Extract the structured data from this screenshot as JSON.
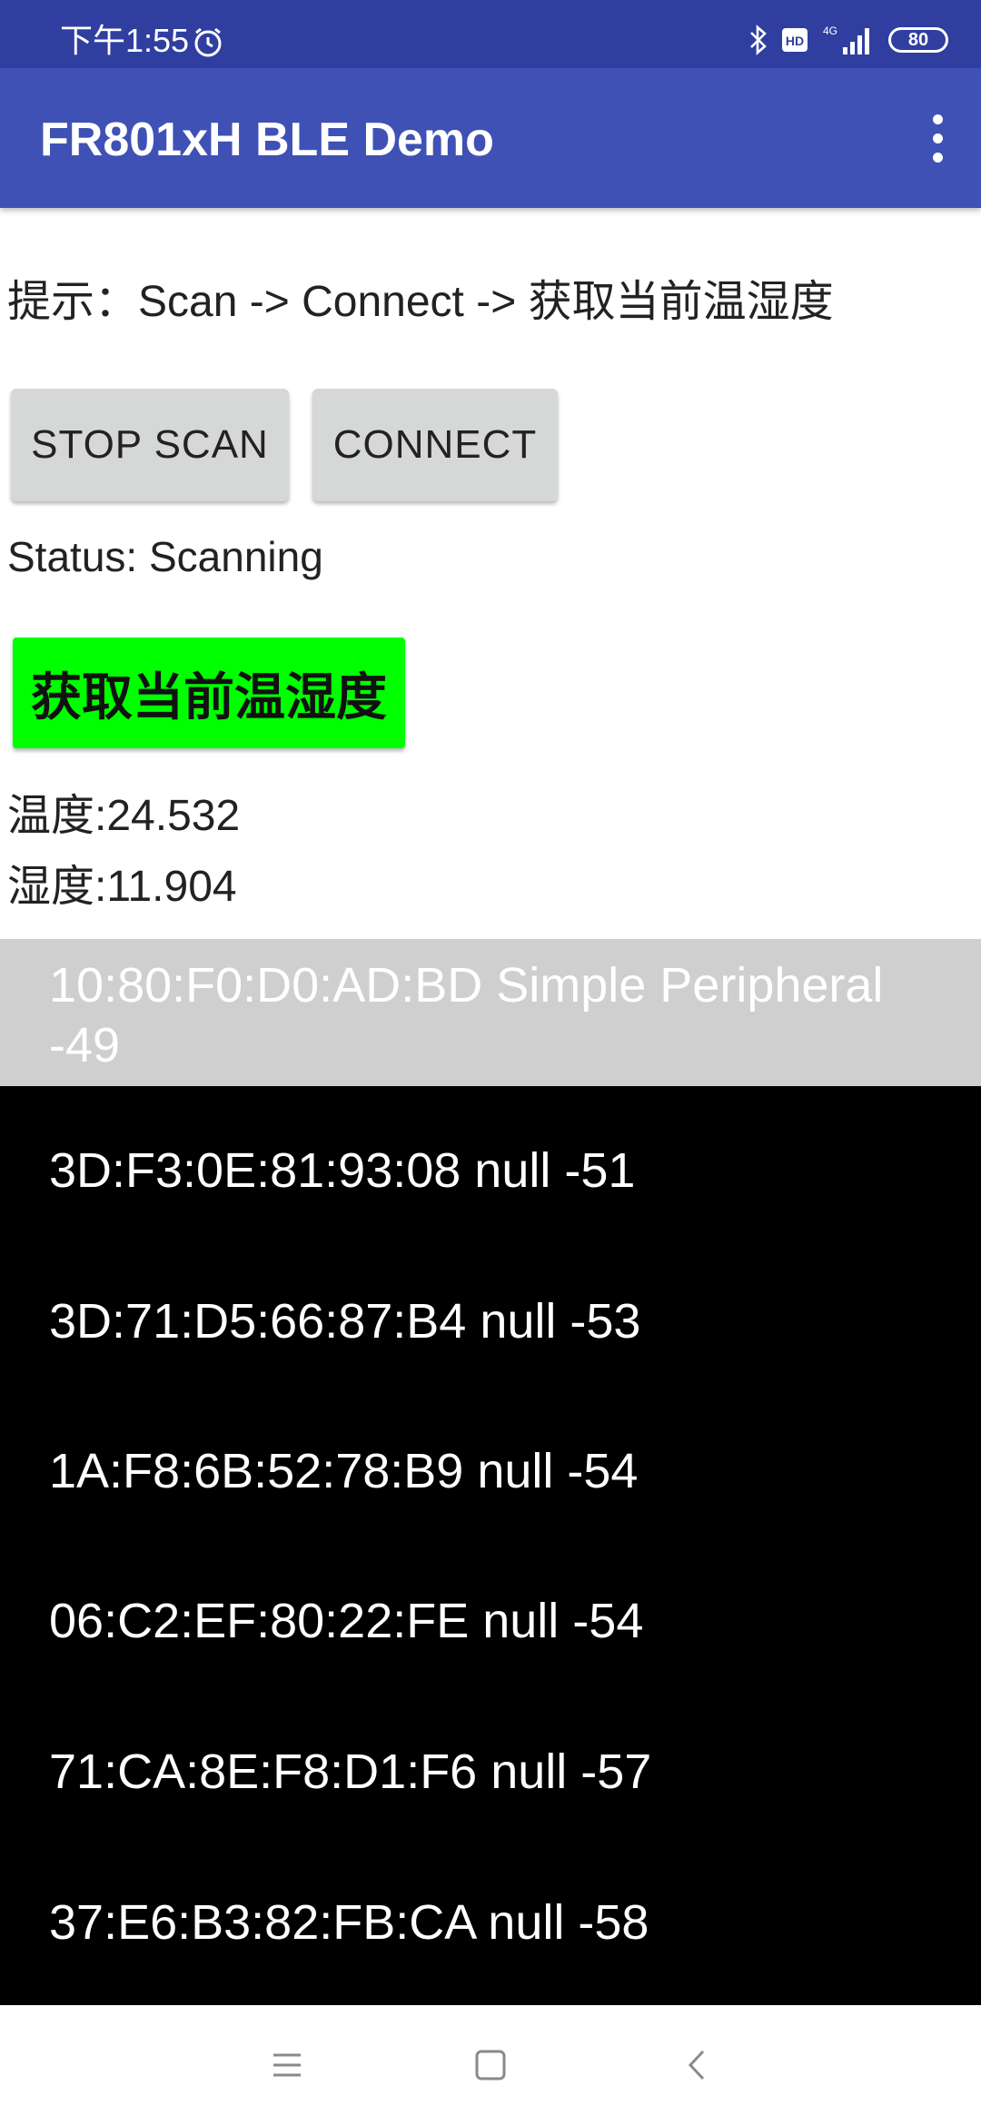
{
  "status_bar": {
    "time": "下午1:55",
    "network": "4G",
    "hd_label": "HD",
    "battery": "80",
    "icons": [
      "alarm-icon",
      "bluetooth-icon",
      "hd-icon",
      "signal-icon",
      "battery-icon"
    ]
  },
  "app_bar": {
    "title": "FR801xH BLE Demo",
    "menu_icon": "more-vert-icon"
  },
  "hint": "提示：Scan -> Connect -> 获取当前温湿度",
  "buttons": {
    "stop_scan": "STOP SCAN",
    "connect": "CONNECT",
    "get_temp_humidity": "获取当前温湿度"
  },
  "status": "Status: Scanning",
  "readings": {
    "temperature": "温度:24.532",
    "humidity": "湿度:11.904"
  },
  "devices": [
    {
      "line1": "10:80:F0:D0:AD:BD Simple Peripheral",
      "line2": "-49",
      "selected": true
    },
    {
      "text": "3D:F3:0E:81:93:08 null -51"
    },
    {
      "text": "3D:71:D5:66:87:B4 null -53"
    },
    {
      "text": "1A:F8:6B:52:78:B9 null -54"
    },
    {
      "text": "06:C2:EF:80:22:FE null -54"
    },
    {
      "text": "71:CA:8E:F8:D1:F6 null -57"
    },
    {
      "text": "37:E6:B3:82:FB:CA null -58"
    }
  ],
  "colors": {
    "status_bar": "#303f9f",
    "app_bar": "#3f51b5",
    "get_button": "#00ff00",
    "list_background": "#000000",
    "selected_row": "#cfcfcf"
  },
  "nav_bar": {
    "icons": [
      "menu-icon",
      "home-icon",
      "back-icon"
    ]
  }
}
